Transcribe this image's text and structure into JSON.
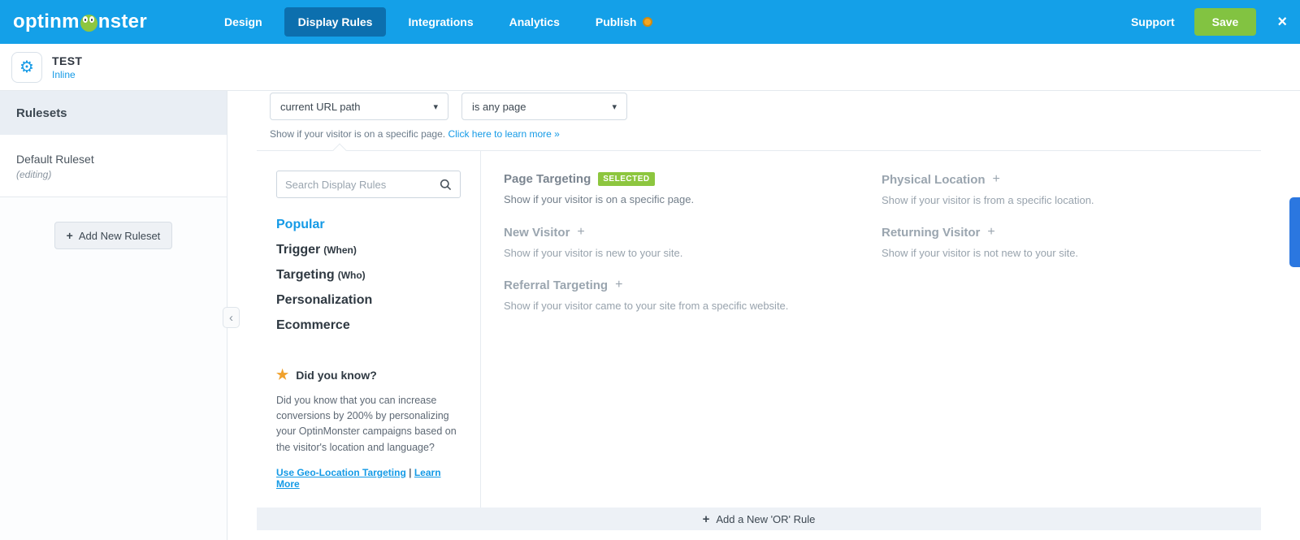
{
  "icons": {
    "gear": "⚙",
    "star": "★",
    "chevron_down": "▾",
    "plus": "+",
    "close": "×",
    "collapse": "‹",
    "separator": "|"
  },
  "topbar": {
    "logo_left": "optinm",
    "logo_right": "nster",
    "nav": [
      {
        "label": "Design"
      },
      {
        "label": "Display Rules"
      },
      {
        "label": "Integrations"
      },
      {
        "label": "Analytics"
      },
      {
        "label": "Publish"
      }
    ],
    "support_label": "Support",
    "save_label": "Save"
  },
  "campaign": {
    "name": "TEST",
    "type": "Inline"
  },
  "sidebar": {
    "header": "Rulesets",
    "ruleset": {
      "name": "Default Ruleset",
      "status": "(editing)"
    },
    "add_label": "Add New Ruleset"
  },
  "rule_row": {
    "field_value": "current URL path",
    "value_value": "is any page",
    "helper_text": "Show if your visitor is on a specific page.",
    "helper_link": "Click here to learn more »"
  },
  "panel": {
    "search_placeholder": "Search Display Rules",
    "categories": [
      {
        "label": "Popular",
        "suffix": ""
      },
      {
        "label": "Trigger",
        "suffix": "(When)"
      },
      {
        "label": "Targeting",
        "suffix": "(Who)"
      },
      {
        "label": "Personalization",
        "suffix": ""
      },
      {
        "label": "Ecommerce",
        "suffix": ""
      }
    ],
    "did_you_know": {
      "title": "Did you know?",
      "body": "Did you know that you can increase conversions by 200% by personalizing your OptinMonster campaigns based on the visitor's location and language?",
      "link_geo": "Use Geo-Location Targeting",
      "link_more": "Learn More"
    },
    "selected_badge": "SELECTED",
    "rules": [
      {
        "title": "Page Targeting",
        "desc": "Show if your visitor is on a specific page.",
        "selected": true
      },
      {
        "title": "Physical Location",
        "desc": "Show if your visitor is from a specific location.",
        "selected": false
      },
      {
        "title": "New Visitor",
        "desc": "Show if your visitor is new to your site.",
        "selected": false
      },
      {
        "title": "Returning Visitor",
        "desc": "Show if your visitor is not new to your site.",
        "selected": false
      },
      {
        "title": "Referral Targeting",
        "desc": "Show if your visitor came to your site from a specific website.",
        "selected": false
      }
    ]
  },
  "footer": {
    "add_or_rule": "Add a New 'OR' Rule"
  },
  "colors": {
    "brand_blue": "#14a0e8",
    "active_nav": "#0c6fae",
    "save_green": "#82c341",
    "badge_green": "#8dc63f",
    "link_blue": "#149ae6",
    "monster_green": "#8dc63f",
    "publish_orange": "#f5a623"
  }
}
